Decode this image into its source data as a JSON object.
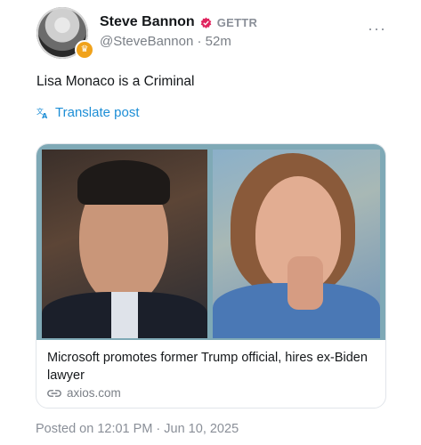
{
  "author": {
    "display_name": "Steve Bannon",
    "platform": "GETTR",
    "handle": "@SteveBannon",
    "relative_time": "52m",
    "verified_color": "#e0245e",
    "badge_color": "#f0a21b",
    "avatar_icon": "user-avatar"
  },
  "post": {
    "text": "Lisa Monaco is a Criminal",
    "translate_label": "Translate post",
    "more_icon": "ellipsis-icon"
  },
  "link_card": {
    "title": "Microsoft promotes former Trump official, hires ex-Biden lawyer",
    "domain": "axios.com",
    "border_color": "#7fa9b6"
  },
  "footer": {
    "posted": "Posted on 12:01 PM · Jun 10, 2025"
  },
  "colors": {
    "accent": "#1d8ed6",
    "muted": "#8a8f98"
  }
}
